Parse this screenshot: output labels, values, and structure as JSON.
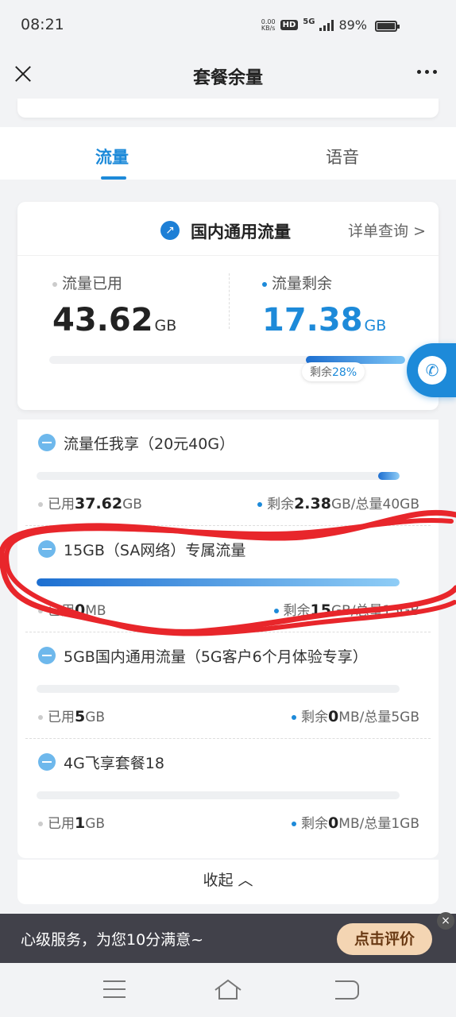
{
  "status_bar": {
    "time": "08:21",
    "net_speed_value": "0.00",
    "net_speed_unit": "KB/s",
    "hd_label": "HD",
    "network_label": "5G",
    "battery_text": "89%"
  },
  "nav": {
    "title": "套餐余量",
    "close_icon": "close-icon",
    "more_icon": "more-icon"
  },
  "tabs": [
    {
      "label": "流量",
      "active": true
    },
    {
      "label": "语音",
      "active": false
    }
  ],
  "summary": {
    "title": "国内通用流量",
    "detail_link": "详单查询 >",
    "used_label": "流量已用",
    "used_value": "43.62",
    "used_unit": "GB",
    "remain_label": "流量剩余",
    "remain_value": "17.38",
    "remain_unit": "GB",
    "remain_badge_prefix": "剩余",
    "remain_percent_text": "28%",
    "remain_fraction": 0.28
  },
  "packages": [
    {
      "name": "流量任我享（20元40G）",
      "used_prefix": "已用",
      "used_value": "37.62",
      "used_unit": "GB",
      "remain_prefix": "剩余",
      "remain_value": "2.38",
      "remain_suffix": "GB/总量40GB",
      "remain_fraction": 0.06
    },
    {
      "name": "15GB（SA网络）专属流量",
      "used_prefix": "已用",
      "used_value": "0",
      "used_unit": "MB",
      "remain_prefix": "剩余",
      "remain_value": "15",
      "remain_suffix": "GB/总量15GB",
      "remain_fraction": 1.0
    },
    {
      "name": "5GB国内通用流量（5G客户6个月体验专享）",
      "used_prefix": "已用",
      "used_value": "5",
      "used_unit": "GB",
      "remain_prefix": "剩余",
      "remain_value": "0",
      "remain_suffix": "MB/总量5GB",
      "remain_fraction": 0.0
    },
    {
      "name": "4G飞享套餐18",
      "used_prefix": "已用",
      "used_value": "1",
      "used_unit": "GB",
      "remain_prefix": "剩余",
      "remain_value": "0",
      "remain_suffix": "MB/总量1GB",
      "remain_fraction": 0.0
    }
  ],
  "collapse_label": "收起 ︿",
  "promo": {
    "text": "心级服务，为您10分满意~",
    "button": "点击评价",
    "close_symbol": "×"
  },
  "colors": {
    "accent": "#1d8ad9",
    "annotation": "#e8262b"
  }
}
